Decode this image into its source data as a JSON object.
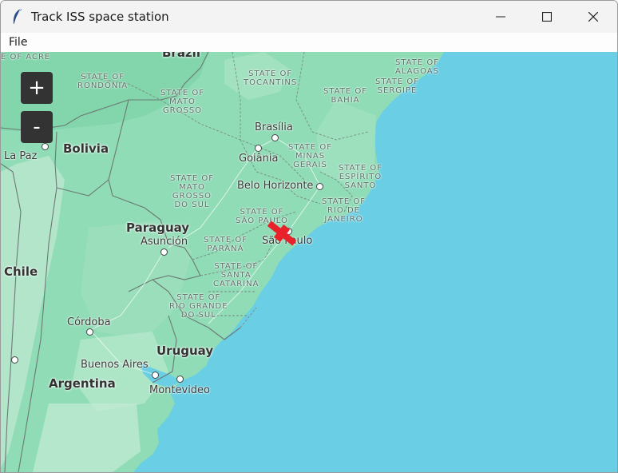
{
  "window": {
    "title": "Track ISS space station",
    "app_icon": "feather-icon",
    "controls": [
      "minimize-icon",
      "maximize-icon",
      "close-icon"
    ]
  },
  "menu": {
    "items": [
      "File"
    ]
  },
  "map": {
    "zoom_in_label": "+",
    "zoom_out_label": "-",
    "marker_icon": "iss-marker-icon",
    "marker_color": "#e8212a",
    "ocean_color": "#6acfe4",
    "land_color": "#8fdcb6",
    "labels": {
      "countries": {
        "brazil": "Brazil",
        "bolivia": "Bolivia",
        "paraguay": "Paraguay",
        "chile": "Chile",
        "uruguay": "Uruguay",
        "argentina": "Argentina"
      },
      "cities": {
        "la_paz": "La Paz",
        "brasilia": "Brasília",
        "goiania": "Goiânia",
        "belo_horizonte": "Belo Horizonte",
        "sao_paulo": "São Paulo",
        "asuncion": "Asunción",
        "cordoba": "Córdoba",
        "buenos_aires": "Buenos Aires",
        "montevideo": "Montevideo"
      },
      "states": {
        "acre": "E OF ACRE",
        "rondonia": "STATE OF\nRONDÔNIA",
        "mato_grosso": "STATE OF\nMATO\nGROSSO",
        "tocantins": "STATE OF\nTOCANTINS",
        "alagoas": "STATE OF\nALAGOAS",
        "sergipe": "STATE OF\nSERGIPE",
        "bahia": "STATE OF\nBAHIA",
        "minas_gerais": "STATE OF\nMINAS\nGERAIS",
        "espirito_santo": "STATE OF\nESPÍRITO\nSANTO",
        "mato_grosso_do_sul": "STATE OF\nMATO\nGROSSO\nDO SUL",
        "rio_de_janeiro": "STATE OF\nRIO DE\nJANEIRO",
        "sao_paulo": "STATE OF\nSÃO PAULO",
        "parana": "STATE OF\nPARANÁ",
        "santa_catarina": "STATE OF\nSANTA\nCATARINA",
        "rio_grande_do_sul": "STATE OF\nRIO GRANDE\nDO SUL"
      }
    }
  }
}
